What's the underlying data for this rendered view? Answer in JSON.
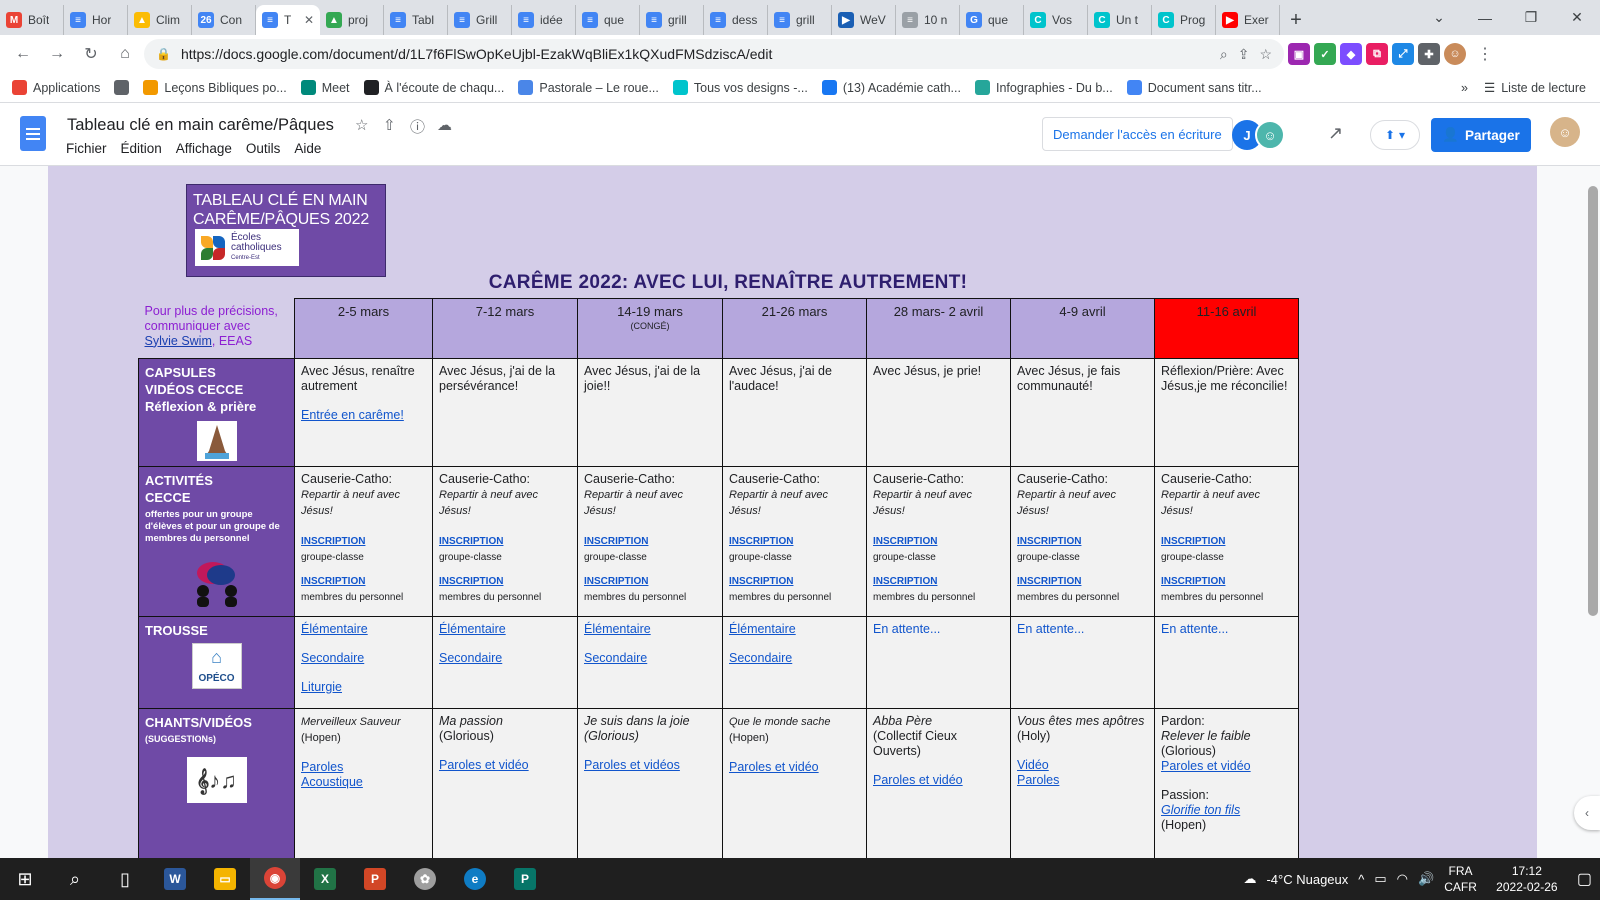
{
  "browser": {
    "tabs": [
      {
        "label": "Boît",
        "icon": "gmail-icon",
        "color": "#ea4335",
        "glyph": "M"
      },
      {
        "label": "Hor",
        "icon": "docs-icon",
        "color": "#4285f4",
        "glyph": "≡"
      },
      {
        "label": "Clim",
        "icon": "drive-icon",
        "color": "#fbbc04",
        "glyph": "▲"
      },
      {
        "label": "Con",
        "icon": "calendar-icon",
        "color": "#4285f4",
        "glyph": "26"
      },
      {
        "label": "T",
        "icon": "docs-icon",
        "color": "#4285f4",
        "glyph": "≡",
        "active": true
      },
      {
        "label": "proj",
        "icon": "drive-icon",
        "color": "#34a853",
        "glyph": "▲"
      },
      {
        "label": "Tabl",
        "icon": "docs-icon",
        "color": "#4285f4",
        "glyph": "≡"
      },
      {
        "label": "Grill",
        "icon": "docs-icon",
        "color": "#4285f4",
        "glyph": "≡"
      },
      {
        "label": "idée",
        "icon": "docs-icon",
        "color": "#4285f4",
        "glyph": "≡"
      },
      {
        "label": "que",
        "icon": "docs-icon",
        "color": "#4285f4",
        "glyph": "≡"
      },
      {
        "label": "grill",
        "icon": "docs-icon",
        "color": "#4285f4",
        "glyph": "≡"
      },
      {
        "label": "dess",
        "icon": "docs-icon",
        "color": "#4285f4",
        "glyph": "≡"
      },
      {
        "label": "grill",
        "icon": "docs-icon",
        "color": "#4285f4",
        "glyph": "≡"
      },
      {
        "label": "WeV",
        "icon": "wevideo-icon",
        "color": "#1a5fb4",
        "glyph": "▶"
      },
      {
        "label": "10 n",
        "icon": "page-icon",
        "color": "#9aa0a6",
        "glyph": "≡"
      },
      {
        "label": "que",
        "icon": "google-icon",
        "color": "#4285f4",
        "glyph": "G"
      },
      {
        "label": "Vos",
        "icon": "canva-icon",
        "color": "#00c4cc",
        "glyph": "C"
      },
      {
        "label": "Un t",
        "icon": "canva-icon",
        "color": "#00c4cc",
        "glyph": "C"
      },
      {
        "label": "Prog",
        "icon": "canva-icon",
        "color": "#00c4cc",
        "glyph": "C"
      },
      {
        "label": "Exer",
        "icon": "youtube-icon",
        "color": "#ff0000",
        "glyph": "▶"
      }
    ],
    "url": "https://docs.google.com/document/d/1L7f6FlSwOpKeUjbl-EzakWqBliEx1kQXudFMSdziscA/edit",
    "bookmarks": [
      {
        "label": "Applications",
        "icon": "apps-grid-icon",
        "color": "#ea4335"
      },
      {
        "label": "",
        "icon": "globe-icon",
        "color": "#5f6368"
      },
      {
        "label": "Leçons Bibliques po...",
        "icon": "pencil-icon",
        "color": "#f29900"
      },
      {
        "label": "Meet",
        "icon": "meet-icon",
        "color": "#00897b"
      },
      {
        "label": "À l'écoute de chaqu...",
        "icon": "heart-logo-icon",
        "color": "#202124"
      },
      {
        "label": "Pastorale – Le roue...",
        "icon": "opeco-icon",
        "color": "#4a86e8"
      },
      {
        "label": "Tous vos designs -...",
        "icon": "canva-icon",
        "color": "#00c4cc"
      },
      {
        "label": "(13) Académie cath...",
        "icon": "facebook-icon",
        "color": "#1877f2"
      },
      {
        "label": "Infographies - Du b...",
        "icon": "infographic-icon",
        "color": "#26a69a"
      },
      {
        "label": "Document sans titr...",
        "icon": "docs-icon",
        "color": "#4285f4"
      }
    ],
    "reading_list": "Liste de lecture"
  },
  "docs": {
    "title": "Tableau clé en main carême/Pâques",
    "menu": [
      "Fichier",
      "Édition",
      "Affichage",
      "Outils",
      "Aide"
    ],
    "request_access": "Demander l'accès en écriture",
    "share": "Partager",
    "avatar_initial": "J"
  },
  "document": {
    "header_title": "TABLEAU CLÉ EN MAIN CARÊME/PÂQUES 2022",
    "logo_line1": "Écoles",
    "logo_line2": "catholiques",
    "logo_line3": "Centre-Est",
    "banner": "CARÊME 2022: AVEC LUI, RENAÎTRE AUTREMENT!",
    "contact_text": "Pour plus de précisions, communiquer avec",
    "contact_name": "Sylvie Swim",
    "contact_org": ", EEAS",
    "weeks": [
      {
        "label": "2-5 mars",
        "sub": ""
      },
      {
        "label": "7-12 mars",
        "sub": ""
      },
      {
        "label": "14-19 mars",
        "sub": "(CONGÉ)"
      },
      {
        "label": "21-26 mars",
        "sub": ""
      },
      {
        "label": "28 mars- 2 avril",
        "sub": ""
      },
      {
        "label": "4-9 avril",
        "sub": ""
      },
      {
        "label": "11-16 avril",
        "sub": ""
      }
    ],
    "rows": {
      "capsules": {
        "title1": "CAPSULES",
        "title2": "VIDÉOS CECCE",
        "title3": "Réflexion & prière",
        "cells": [
          "Avec Jésus, renaître autrement",
          "Avec Jésus, j'ai de la persévérance!",
          "Avec Jésus, j'ai de la joie!!",
          "Avec Jésus, j'ai de l'audace!",
          "Avec Jésus, je prie!",
          "Avec Jésus, je fais communauté!",
          "Réflexion/Prière: Avec Jésus,je me réconcilie!"
        ],
        "first_link": "Entrée en carême!"
      },
      "activites": {
        "title1": "ACTIVITÉS",
        "title2": "CECCE",
        "small": "offertes pour un groupe d'élèves et pour un groupe de membres du personnel",
        "cell_title": "Causerie-Catho:",
        "cell_italic": "Repartir à neuf avec Jésus!",
        "inscription": "INSCRIPTION",
        "group1": "groupe-classe",
        "group2": "membres du personnel"
      },
      "trousse": {
        "title": "TROUSSE",
        "logo_text": "OPÉCO",
        "elementaire": "Élémentaire",
        "secondaire": "Secondaire",
        "liturgie": "Liturgie",
        "attente": "En attente..."
      },
      "chants": {
        "title": "CHANTS/VIDÉOS",
        "sub": "(SUGGESTIONs)",
        "c1_song": "Merveilleux Sauveur",
        "c1_artist": "(Hopen)",
        "c1_l1": "Paroles",
        "c1_l2": "Acoustique",
        "c2_song": "Ma passion",
        "c2_artist": "(Glorious)",
        "c2_l1": "Paroles et vidéo",
        "c3_song": "Je suis dans la joie",
        "c3_artist": "(Glorious)",
        "c3_l1": "Paroles et vidéos",
        "c4_song": "Que le monde sache",
        "c4_artist": "(Hopen)",
        "c4_l1": "Paroles et vidéo",
        "c5_song": "Abba Père",
        "c5_artist": "(Collectif Cieux Ouverts)",
        "c5_l1": "Paroles et vidéo",
        "c6_song": "Vous êtes mes apôtres",
        "c6_artist": "(Holy)",
        "c6_l1": "Vidéo",
        "c6_l2": "Paroles",
        "c7_pardon": "Pardon:",
        "c7_song1": "Relever le faible",
        "c7_artist1": "(Glorious)",
        "c7_l1": "Paroles et vidéo",
        "c7_passion": "Passion:",
        "c7_song2": "Glorifie ton fils",
        "c7_artist2": "(Hopen)"
      }
    }
  },
  "taskbar": {
    "weather": "-4°C  Nuageux",
    "lang1": "FRA",
    "lang2": "CAFR",
    "time": "17:12",
    "date": "2022-02-26"
  },
  "colors": {
    "header_purple": "#6f4aa6",
    "week_header": "#b5a7dd",
    "last_week_red": "#ff0000",
    "page_lavender": "#d4cde8",
    "share_blue": "#1a73e8"
  }
}
